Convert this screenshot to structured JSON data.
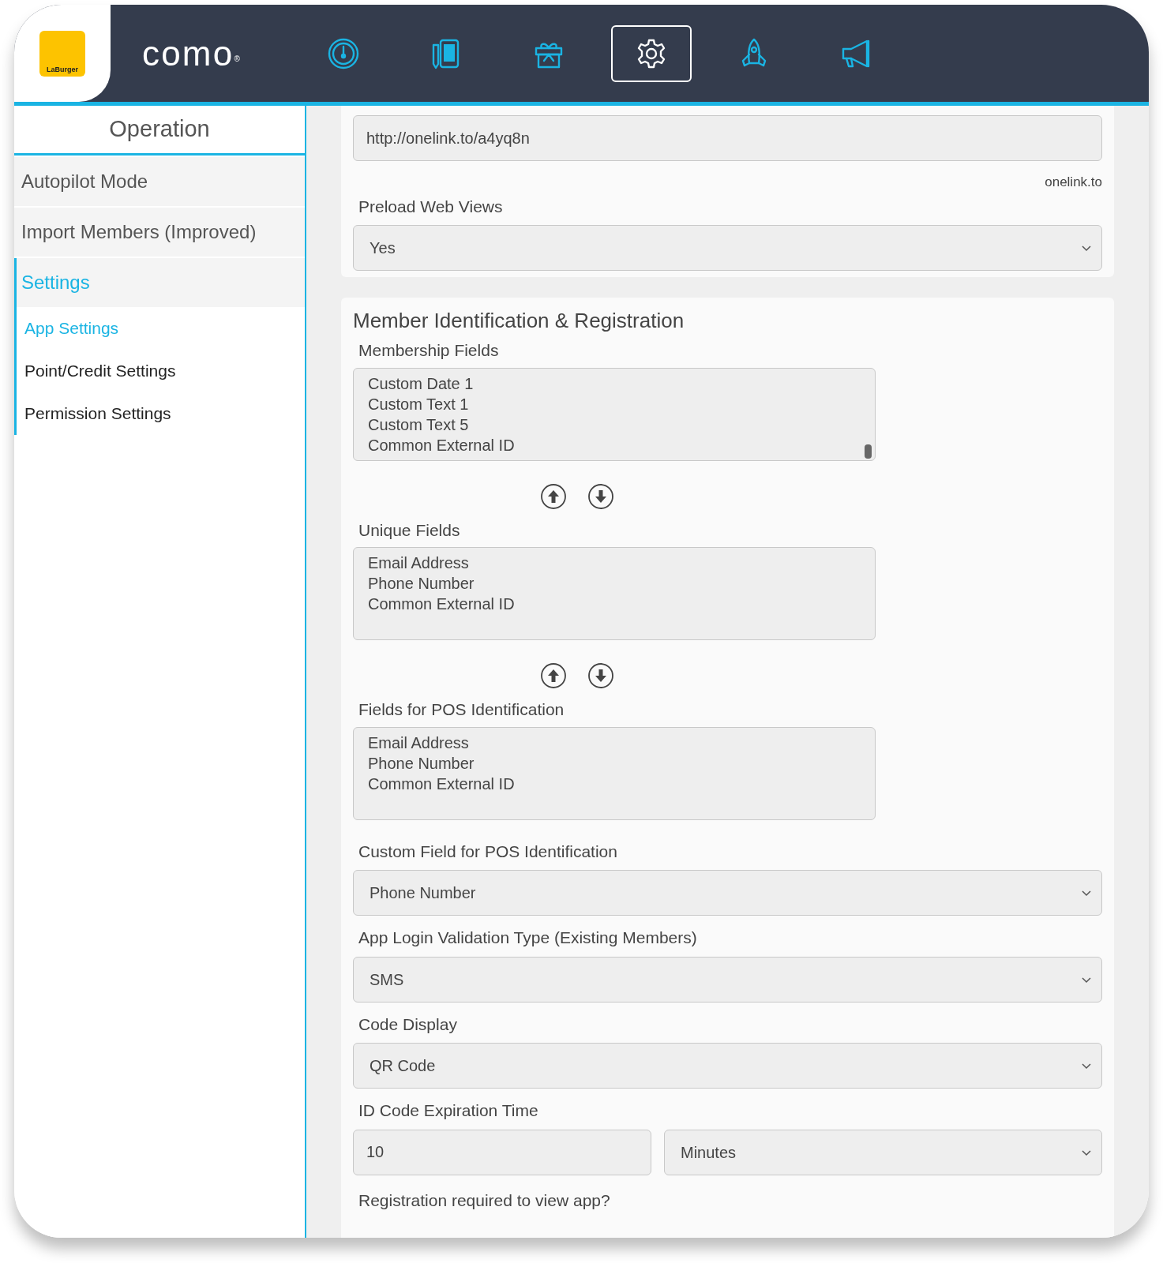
{
  "brand": {
    "logo_text": "LaBurger",
    "name": "como",
    "mark": "®"
  },
  "nav": [
    {
      "kind": "gauge",
      "selected": false
    },
    {
      "kind": "devices",
      "selected": false
    },
    {
      "kind": "gift",
      "selected": false
    },
    {
      "kind": "settings",
      "selected": true
    },
    {
      "kind": "rocket",
      "selected": false
    },
    {
      "kind": "megaphone",
      "selected": false
    }
  ],
  "sidebar": {
    "title": "Operation",
    "items": [
      {
        "label": "Autopilot Mode",
        "selected": false
      },
      {
        "label": "Import Members (Improved)",
        "selected": false
      },
      {
        "label": "Settings",
        "selected": true,
        "children": [
          {
            "label": "App Settings",
            "selected": true
          },
          {
            "label": "Point/Credit Settings",
            "selected": false
          },
          {
            "label": "Permission Settings",
            "selected": false
          }
        ]
      }
    ]
  },
  "top_section": {
    "link_field": {
      "value": "http://onelink.to/a4yq8n"
    },
    "link_hint": "onelink.to",
    "selects": [
      {
        "label": "Preload Web Views",
        "value": "Yes"
      }
    ]
  },
  "member_section": {
    "title": "Member Identification & Registration",
    "lists": [
      {
        "label": "Membership Fields",
        "items": [
          "Custom Date 1",
          "Custom Text 1",
          "Custom Text 5",
          "Common External ID"
        ],
        "scrollable": true,
        "reorder_buttons": true
      },
      {
        "label": "Unique Fields",
        "items": [
          "Email Address",
          "Phone Number",
          "Common External ID"
        ],
        "scrollable": false,
        "reorder_buttons": true
      },
      {
        "label": "Fields for POS Identification",
        "items": [
          "Email Address",
          "Phone Number",
          "Common External ID"
        ],
        "scrollable": false,
        "reorder_buttons": false
      }
    ],
    "selects": [
      {
        "label": "Custom Field for POS Identification",
        "value": "Phone Number"
      },
      {
        "label": "App Login Validation Type (Existing Members)",
        "value": "SMS"
      },
      {
        "label": "Code Display",
        "value": "QR Code"
      }
    ],
    "expiration": {
      "label": "ID Code Expiration Time",
      "value": "10",
      "unit": "Minutes"
    },
    "next_label": "Registration required to view app?"
  }
}
